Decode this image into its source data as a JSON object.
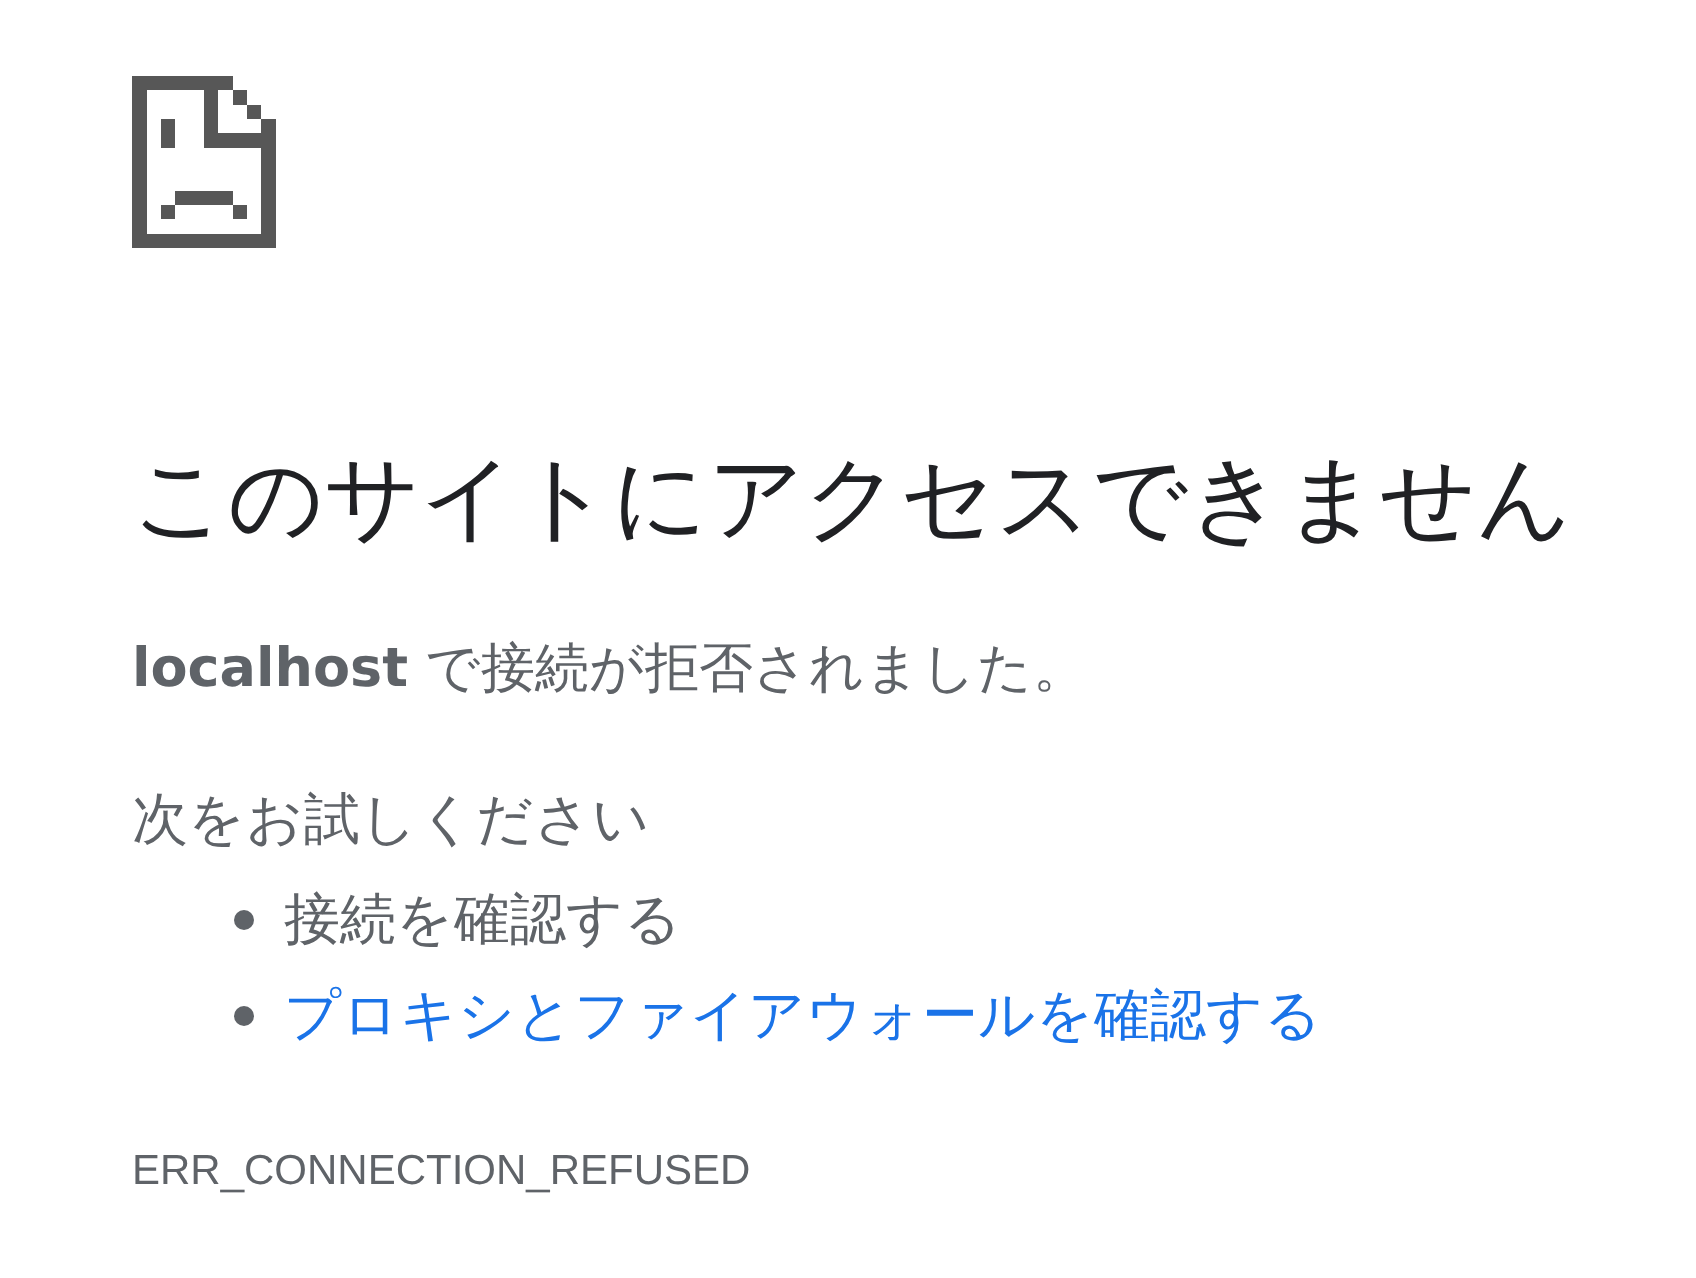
{
  "heading": "このサイトにアクセスできません",
  "message": "**localhost** で接続が拒否されました。",
  "suggestions": {
    "title": "次をお試しください",
    "items": [
      {
        "kind": "text",
        "text": "接続を確認する"
      },
      {
        "kind": "link",
        "text": "プロキシとファイアウォールを確認する"
      }
    ]
  },
  "error_code": "ERR_CONNECTION_REFUSED"
}
